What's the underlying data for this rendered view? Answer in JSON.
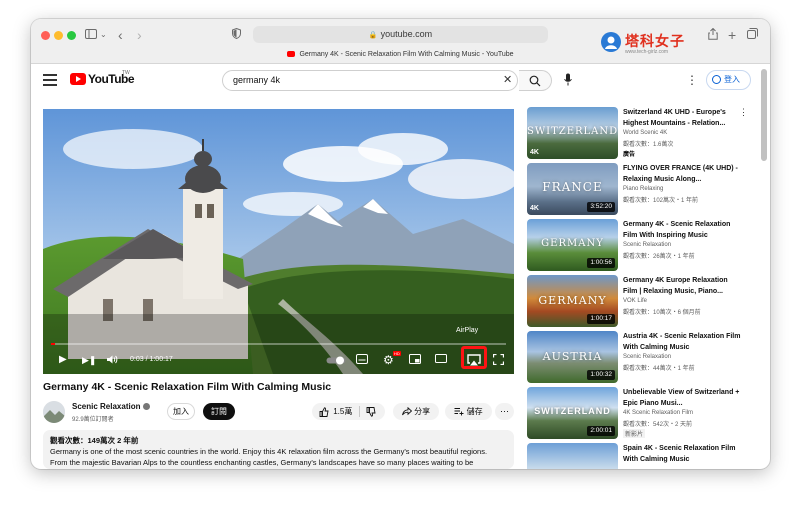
{
  "browser": {
    "url": "youtube.com",
    "tab_title": "Germany 4K - Scenic Relaxation Film With Calming Music - YouTube",
    "traffic_lights": [
      "#ff5f57",
      "#febc2e",
      "#28c840"
    ]
  },
  "watermark": {
    "text": "塔科女子",
    "subtext": "www.tech-girlz.com"
  },
  "youtube": {
    "logo_text": "YouTube",
    "country_code": "TW",
    "search_query": "germany 4k",
    "login_label": "登入"
  },
  "player": {
    "timecode": "0:03 / 1:00:17",
    "progress_fraction": 0.0008,
    "airplay_tooltip": "AirPlay",
    "hd_badge": "HD",
    "highlight_color": "#ff1414"
  },
  "video": {
    "title": "Germany 4K - Scenic Relaxation Film With Calming Music",
    "channel_name": "Scenic Relaxation",
    "subscribers": "92.9萬位訂閱者",
    "join_label": "加入",
    "subscribe_label": "訂閱",
    "likes": "1.5萬",
    "share_label": "分享",
    "save_label": "儲存",
    "description_stats": "觀看次數：149萬次 2 年前",
    "description_line1": "Germany is one of the most scenic countries in the world. Enjoy this 4K relaxation film across the Germany's most beautiful regions.",
    "description_line2": "From the majestic Bavarian Alps to the countless enchanting castles, Germany's landscapes have so many places waiting to be"
  },
  "recommendations": [
    {
      "title": "Switzerland 4K UHD - Europe's Highest Mountains - Relation...",
      "channel": "World Scenic 4K",
      "views": "觀看次數：1.6萬次",
      "badge": "廣告",
      "thumb_text": "SWITZERLAND",
      "duration": "",
      "badge4k": "4K"
    },
    {
      "title": "FLYING OVER FRANCE (4K UHD) - Relaxing Music Along...",
      "channel": "Piano Relaxing",
      "views": "觀看次數：102萬次・1 年前",
      "badge": "",
      "thumb_text": "FRANCE",
      "duration": "3:52:20",
      "badge4k": "4K"
    },
    {
      "title": "Germany 4K - Scenic Relaxation Film With Inspiring Music",
      "channel": "Scenic Relaxation",
      "views": "觀看次數：26萬次・1 年前",
      "badge": "",
      "thumb_text": "GERMANY",
      "duration": "1:00:56",
      "badge4k": ""
    },
    {
      "title": "Germany 4K Europe Relaxation Film | Relaxing Music, Piano...",
      "channel": "VOK Life",
      "views": "觀看次數：10萬次・6 個月前",
      "badge": "",
      "thumb_text": "GERMANY",
      "duration": "1:00:17",
      "badge4k": ""
    },
    {
      "title": "Austria 4K - Scenic Relaxation Film With Calming Music",
      "channel": "Scenic Relaxation",
      "views": "觀看次數：44萬次・1 年前",
      "badge": "",
      "thumb_text": "AUSTRIA",
      "duration": "1:00:32",
      "badge4k": ""
    },
    {
      "title": "Unbelievable View of Switzerland + Epic Piano Musi...",
      "channel": "4K Scenic Relaxation Film",
      "views": "觀看次數：542次・2 天前",
      "badge": "新影片",
      "thumb_text": "SWITZERLAND",
      "duration": "2:00:01",
      "badge4k": ""
    },
    {
      "title": "Spain 4K - Scenic Relaxation Film With Calming Music",
      "channel": "",
      "views": "",
      "badge": "",
      "thumb_text": "",
      "duration": "",
      "badge4k": ""
    }
  ]
}
